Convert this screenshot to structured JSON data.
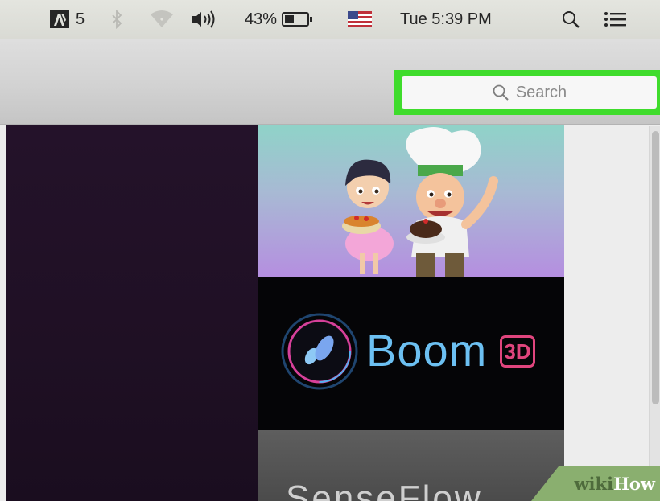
{
  "menubar": {
    "adobe_count": "5",
    "battery_percent": "43%",
    "battery_level": 0.43,
    "clock": "Tue 5:39 PM",
    "icons": [
      "adobe-icon",
      "bluetooth-icon",
      "wifi-icon",
      "volume-icon",
      "battery-icon",
      "us-flag-icon",
      "spotlight-icon",
      "notification-list-icon"
    ]
  },
  "toolbar": {
    "search_placeholder": "Search",
    "highlight_color": "#3fdc2c"
  },
  "tiles": [
    {
      "name": "cooking-game-banner"
    },
    {
      "name": "boom-3d-banner",
      "title": "Boom",
      "badge": "3D"
    },
    {
      "name": "senseflow-banner",
      "title": "SenseFlow"
    }
  ],
  "watermark": {
    "part1": "wiki",
    "part2": "How"
  }
}
